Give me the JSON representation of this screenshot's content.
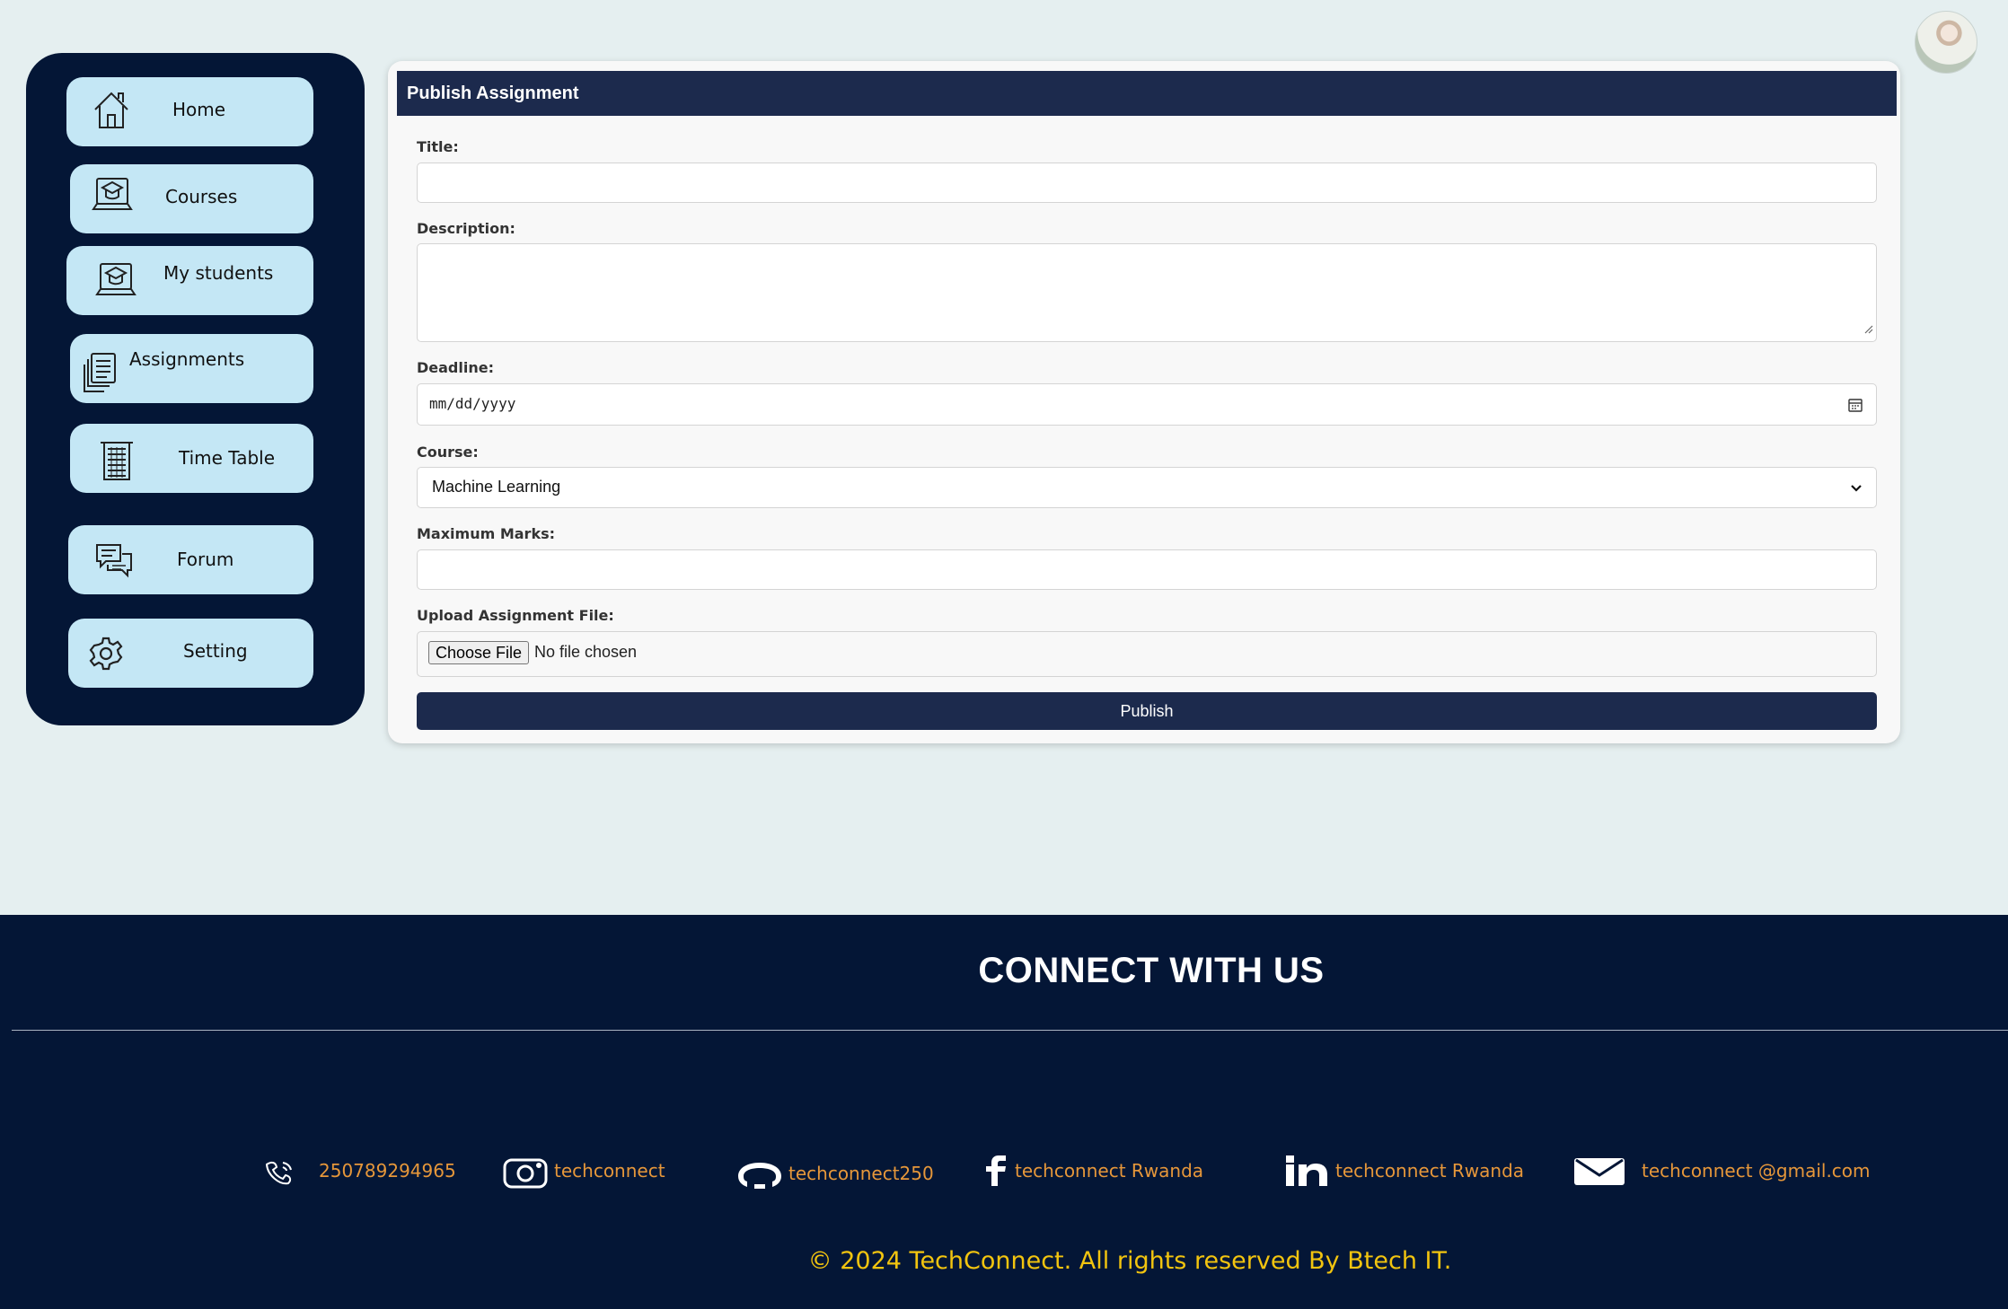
{
  "nav": {
    "items": [
      {
        "label": "Home",
        "icon": "home-icon"
      },
      {
        "label": "Courses",
        "icon": "laptop-graduation-icon"
      },
      {
        "label": "My students",
        "icon": "laptop-graduation-icon"
      },
      {
        "label": "Assignments",
        "icon": "documents-icon"
      },
      {
        "label": "Time Table",
        "icon": "timetable-icon"
      },
      {
        "label": "Forum",
        "icon": "chat-bubbles-icon"
      },
      {
        "label": "Setting",
        "icon": "gear-icon"
      }
    ]
  },
  "form": {
    "header": "Publish Assignment",
    "title_label": "Title:",
    "title_value": "",
    "description_label": "Description:",
    "description_value": "",
    "deadline_label": "Deadline:",
    "deadline_placeholder": "mm/dd/yyyy",
    "course_label": "Course:",
    "course_selected": "Machine Learning",
    "max_marks_label": "Maximum Marks:",
    "max_marks_value": "",
    "upload_label": "Upload Assignment File:",
    "choose_file_label": "Choose File",
    "no_file_text": "No file chosen",
    "publish_label": "Publish"
  },
  "footer": {
    "title": "CONNECT WITH US",
    "contacts": [
      {
        "icon": "phone-icon",
        "text": "250789294965"
      },
      {
        "icon": "instagram-icon",
        "text": "techconnect"
      },
      {
        "icon": "github-icon",
        "text": "techconnect250"
      },
      {
        "icon": "facebook-icon",
        "text": "techconnect Rwanda"
      },
      {
        "icon": "linkedin-icon",
        "text": "techconnect Rwanda"
      },
      {
        "icon": "email-icon",
        "text": "techconnect @gmail.com"
      }
    ],
    "copyright": "© 2024 TechConnect. All rights reserved By Btech IT."
  },
  "colors": {
    "page_bg": "#e5eff0",
    "sidebar_bg": "#041636",
    "nav_item_bg": "#c4e7f5",
    "header_bg": "#1c2a4d",
    "footer_bg": "#041636",
    "contact_text": "#e6973a",
    "copyright_text": "#f2c40f"
  }
}
